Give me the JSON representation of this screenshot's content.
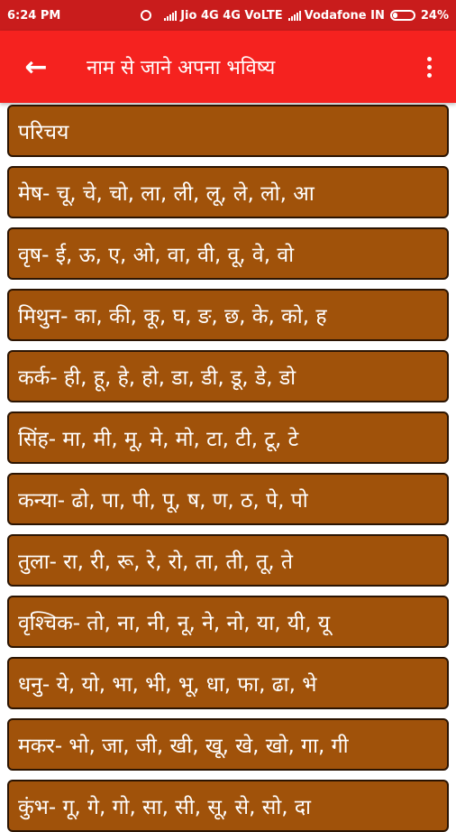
{
  "status_bar": {
    "time": "6:24 PM",
    "carrier1": "Jio 4G 4G VoLTE",
    "carrier2": "Vodafone IN",
    "battery": "24%",
    "icons": [
      "alarm-icon",
      "signal-icon",
      "signal-icon",
      "battery-icon"
    ]
  },
  "app_bar": {
    "title": "नाम से जाने अपना भविष्य",
    "back_icon": "arrow-left-icon",
    "menu_icon": "more-vert-icon",
    "color": "#f5221f"
  },
  "list": {
    "item_color": "#a0520a",
    "items": [
      {
        "label": "परिचय"
      },
      {
        "label": "मेष- चू, चे, चो, ला, ली, लू, ले, लो, आ"
      },
      {
        "label": "वृष- ई, ऊ, ए, ओ, वा, वी, वू, वे, वो"
      },
      {
        "label": "मिथुन- का, की, कू, घ, ङ, छ, के, को, ह"
      },
      {
        "label": "कर्क- ही, हू, हे, हो, डा, डी, डू, डे, डो"
      },
      {
        "label": "सिंह- मा, मी, मू, मे, मो, टा, टी, टू, टे"
      },
      {
        "label": "कन्या- ढो, पा, पी, पू, ष, ण, ठ, पे, पो"
      },
      {
        "label": "तुला- रा, री, रू, रे, रो, ता, ती, तू, ते"
      },
      {
        "label": "वृश्चिक- तो, ना, नी, नू, ने, नो, या, यी, यू"
      },
      {
        "label": "धनु- ये, यो, भा, भी, भू, धा, फा, ढा, भे"
      },
      {
        "label": "मकर- भो, जा, जी, खी, खू, खे, खो, गा, गी"
      },
      {
        "label": "कुंभ- गू, गे, गो, सा, सी, सू, से, सो, दा"
      }
    ]
  }
}
